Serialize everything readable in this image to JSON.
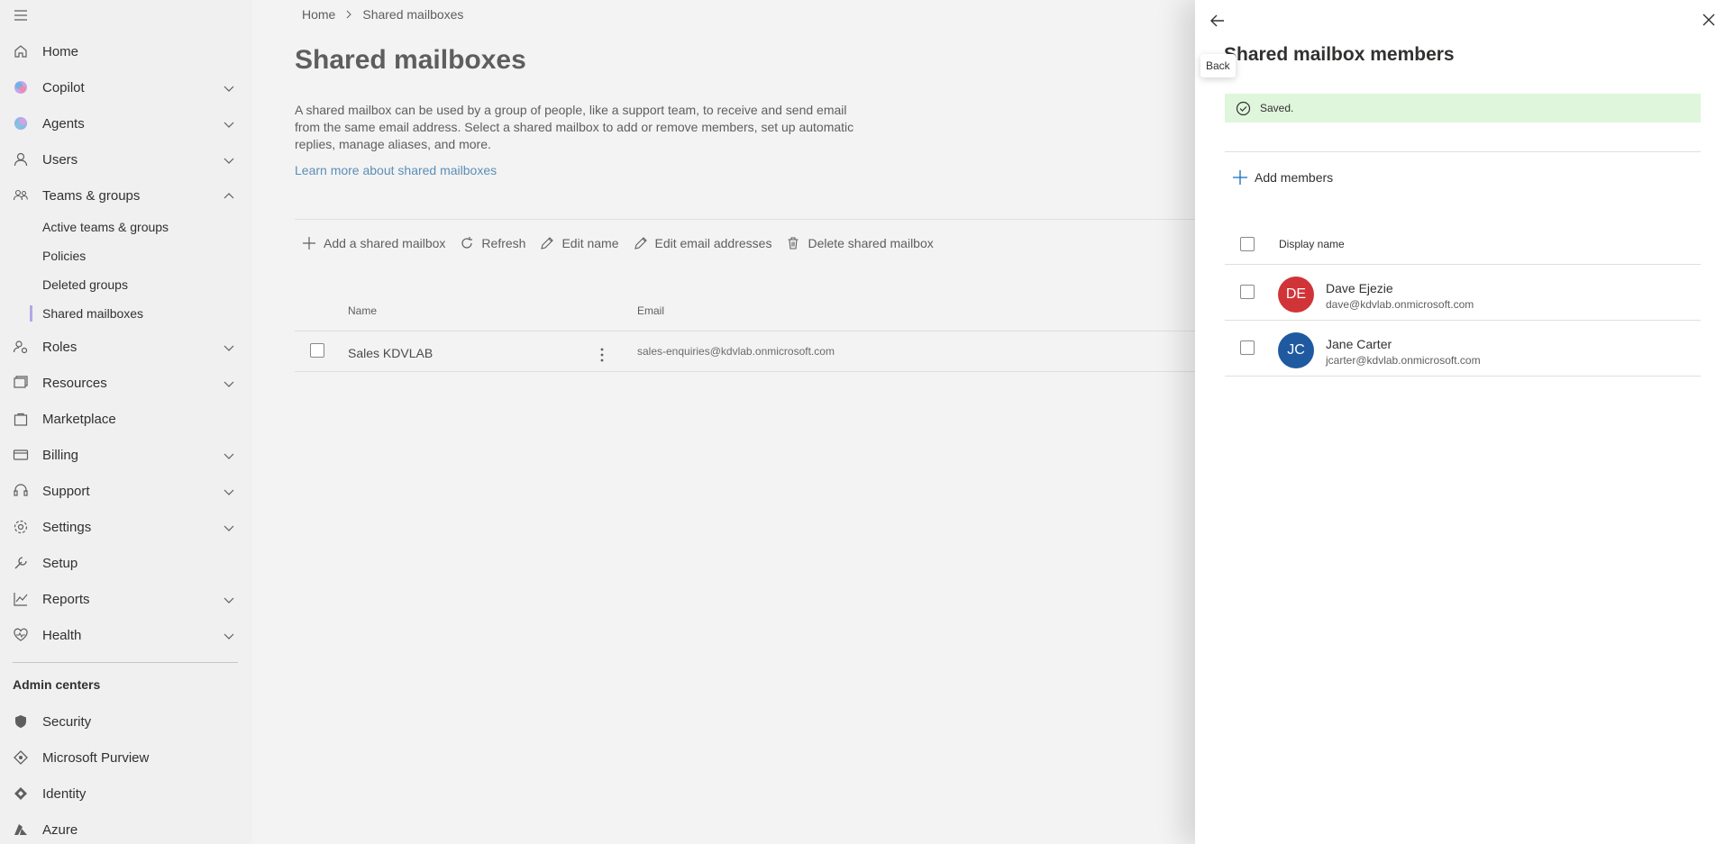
{
  "sidebar": {
    "nav": [
      {
        "label": "Home",
        "icon": "home-icon",
        "chevron": false
      },
      {
        "label": "Copilot",
        "icon": "copilot-icon",
        "chevron": true
      },
      {
        "label": "Agents",
        "icon": "agents-icon",
        "chevron": true
      },
      {
        "label": "Users",
        "icon": "user-icon",
        "chevron": true
      },
      {
        "label": "Teams & groups",
        "icon": "teams-groups-icon",
        "chevron": true,
        "expanded": true
      }
    ],
    "sub_items": [
      "Active teams & groups",
      "Policies",
      "Deleted groups",
      "Shared mailboxes"
    ],
    "active_sub": "Shared mailboxes",
    "nav2": [
      {
        "label": "Roles",
        "icon": "roles-icon",
        "chevron": true
      },
      {
        "label": "Resources",
        "icon": "resources-icon",
        "chevron": true
      },
      {
        "label": "Marketplace",
        "icon": "marketplace-icon",
        "chevron": false
      },
      {
        "label": "Billing",
        "icon": "billing-icon",
        "chevron": true
      },
      {
        "label": "Support",
        "icon": "support-icon",
        "chevron": true
      },
      {
        "label": "Settings",
        "icon": "settings-icon",
        "chevron": true
      },
      {
        "label": "Setup",
        "icon": "setup-icon",
        "chevron": false
      },
      {
        "label": "Reports",
        "icon": "reports-icon",
        "chevron": true
      },
      {
        "label": "Health",
        "icon": "health-icon",
        "chevron": true
      }
    ],
    "admin_centers_title": "Admin centers",
    "admin_centers": [
      {
        "label": "Security",
        "icon": "security-icon"
      },
      {
        "label": "Microsoft Purview",
        "icon": "purview-icon"
      },
      {
        "label": "Identity",
        "icon": "identity-icon"
      },
      {
        "label": "Azure",
        "icon": "azure-icon"
      }
    ]
  },
  "breadcrumb": {
    "home": "Home",
    "current": "Shared mailboxes"
  },
  "main": {
    "title": "Shared mailboxes",
    "description": "A shared mailbox can be used by a group of people, like a support team, to receive and send email from the same email address. Select a shared mailbox to add or remove members, set up automatic replies, manage aliases, and more.",
    "learn_more": "Learn more about shared mailboxes",
    "commands": {
      "add": "Add a shared mailbox",
      "refresh": "Refresh",
      "edit_name": "Edit name",
      "edit_email": "Edit email addresses",
      "delete": "Delete shared mailbox"
    },
    "table": {
      "headers": {
        "name": "Name",
        "email": "Email"
      },
      "rows": [
        {
          "name": "Sales KDVLAB",
          "email": "sales-enquiries@kdvlab.onmicrosoft.com"
        }
      ]
    }
  },
  "panel": {
    "tooltip": "Back",
    "title": "Shared mailbox members",
    "saved": "Saved.",
    "add_members": "Add members",
    "column": "Display name",
    "members": [
      {
        "initials": "DE",
        "name": "Dave Ejezie",
        "email": "dave@kdvlab.onmicrosoft.com",
        "color": "#d13438"
      },
      {
        "initials": "JC",
        "name": "Jane Carter",
        "email": "jcarter@kdvlab.onmicrosoft.com",
        "color": "#1f5aa0"
      }
    ]
  },
  "colors": {
    "accent": "#5a8fb8",
    "sidebar_bg": "#f0f0f0",
    "success_bg": "#dff6dd"
  }
}
